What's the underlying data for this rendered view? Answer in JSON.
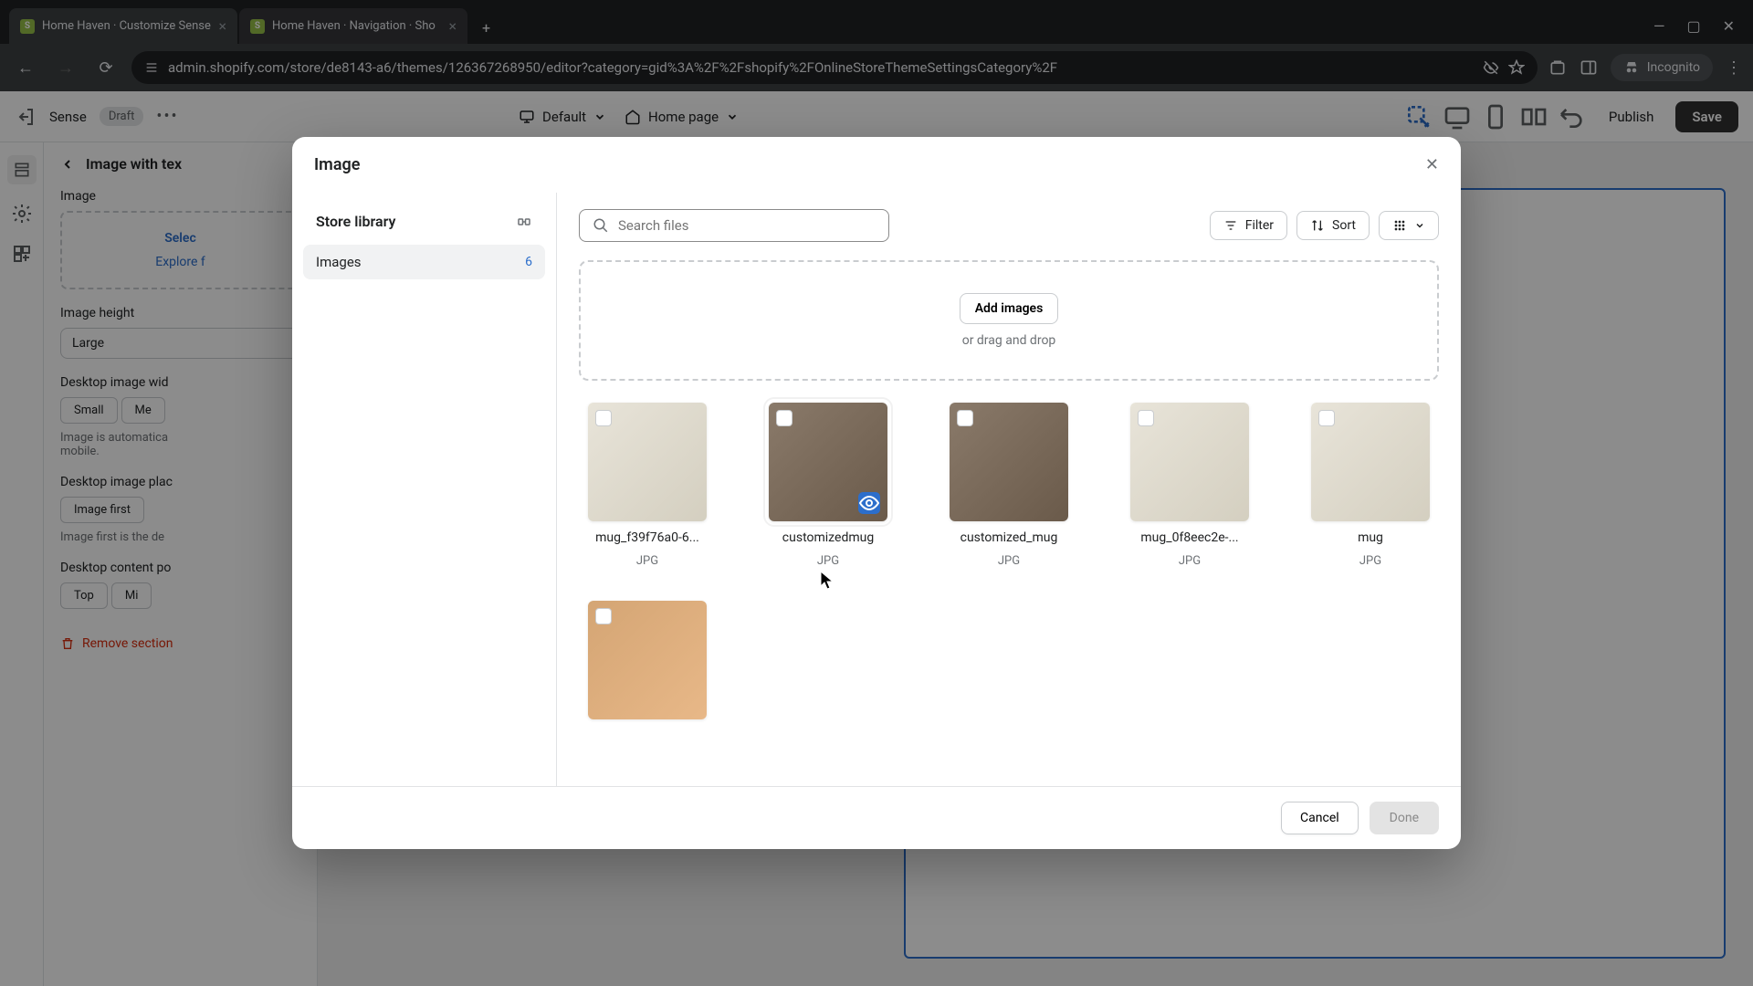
{
  "browser": {
    "tabs": [
      {
        "title": "Home Haven · Customize Sense"
      },
      {
        "title": "Home Haven · Navigation · Sho"
      }
    ],
    "url": "admin.shopify.com/store/de8143-a6/themes/126367268950/editor?category=gid%3A%2F%2Fshopify%2FOnlineStoreThemeSettingsCategory%2F",
    "incognito": "Incognito"
  },
  "editor": {
    "theme": "Sense",
    "status": "Draft",
    "viewport": "Default",
    "page": "Home page",
    "publish": "Publish",
    "save": "Save"
  },
  "sidebar": {
    "breadcrumb": "Image with tex",
    "image_label": "Image",
    "select": "Selec",
    "explore": "Explore f",
    "height_label": "Image height",
    "height_value": "Large",
    "width_label": "Desktop image wid",
    "width_small": "Small",
    "width_med": "Me",
    "mobile_note": "Image is automatica\nmobile.",
    "place_label": "Desktop image plac",
    "place_value": "Image first",
    "place_note": "Image first is the de",
    "content_label": "Desktop content po",
    "content_top": "Top",
    "content_mi": "Mi",
    "remove": "Remove section"
  },
  "modal": {
    "title": "Image",
    "store_library": "Store library",
    "images_label": "Images",
    "images_count": "6",
    "search_placeholder": "Search files",
    "filter": "Filter",
    "sort": "Sort",
    "add_images": "Add images",
    "drag_drop": "or drag and drop",
    "cancel": "Cancel",
    "done": "Done",
    "items": [
      {
        "name": "mug_f39f76a0-6...",
        "type": "JPG",
        "variant": "light"
      },
      {
        "name": "customizedmug",
        "type": "JPG",
        "variant": "dark",
        "hovered": true
      },
      {
        "name": "customized_mug",
        "type": "JPG",
        "variant": "dark"
      },
      {
        "name": "mug_0f8eec2e-...",
        "type": "JPG",
        "variant": "light"
      },
      {
        "name": "mug",
        "type": "JPG",
        "variant": "light"
      },
      {
        "name": "",
        "type": "",
        "variant": "orange"
      }
    ]
  }
}
